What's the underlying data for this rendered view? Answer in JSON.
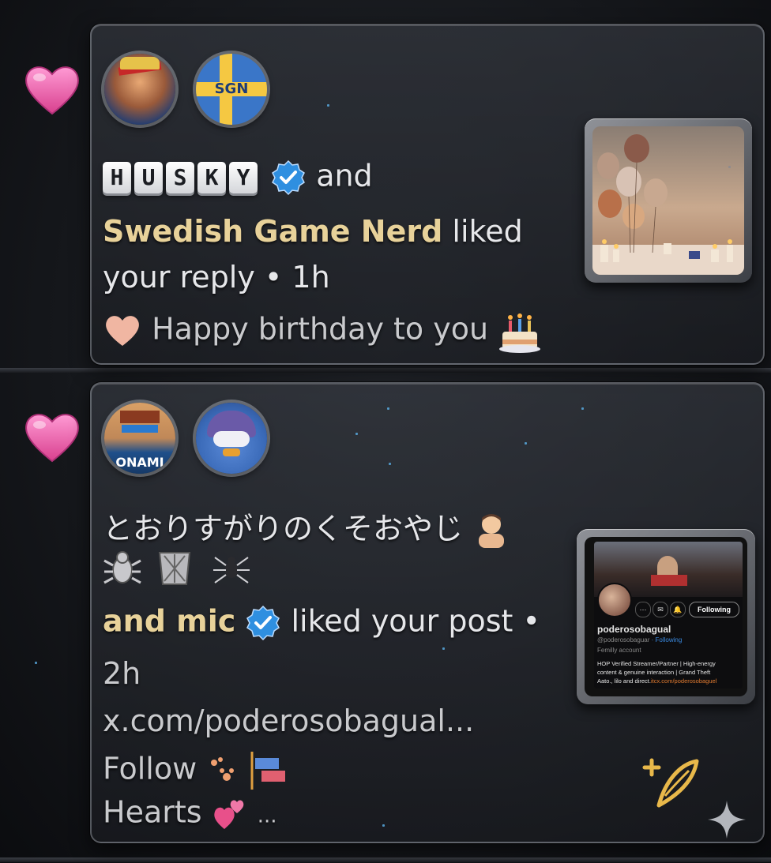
{
  "notifications": [
    {
      "line1": {
        "keys": [
          "H",
          "U",
          "S",
          "K",
          "Y"
        ],
        "and": "and"
      },
      "line2": {
        "name": "Swedish Game Nerd",
        "action": "liked"
      },
      "line3": {
        "text": "your reply • 1h"
      },
      "line4": {
        "text": "Happy birthday to you"
      },
      "avatar2_label": "SGN"
    },
    {
      "line1": {
        "text": "とおりすがりのくそおやじ"
      },
      "line3": {
        "name": "and mic",
        "action": "liked your post •"
      },
      "line4": {
        "text": "2h"
      },
      "line5": {
        "text": "x.com/poderosobagual..."
      },
      "line6": {
        "text": "Follow"
      },
      "line7": {
        "text": "Hearts",
        "more": "..."
      },
      "avatar1_label": "ONAMI",
      "profile_card": {
        "name": "poderosobagual",
        "handle": "@poderosobaguar",
        "following_tag": "· Following",
        "account_type": "Femilly account",
        "bio": [
          "HOP Verified Streamer/Partner | High-energy",
          "content & genuine interaction | Grand Theft",
          "Aato., lilo and direct."
        ],
        "link": "itcx.com/poderosobaguel",
        "button": "Following"
      }
    }
  ]
}
